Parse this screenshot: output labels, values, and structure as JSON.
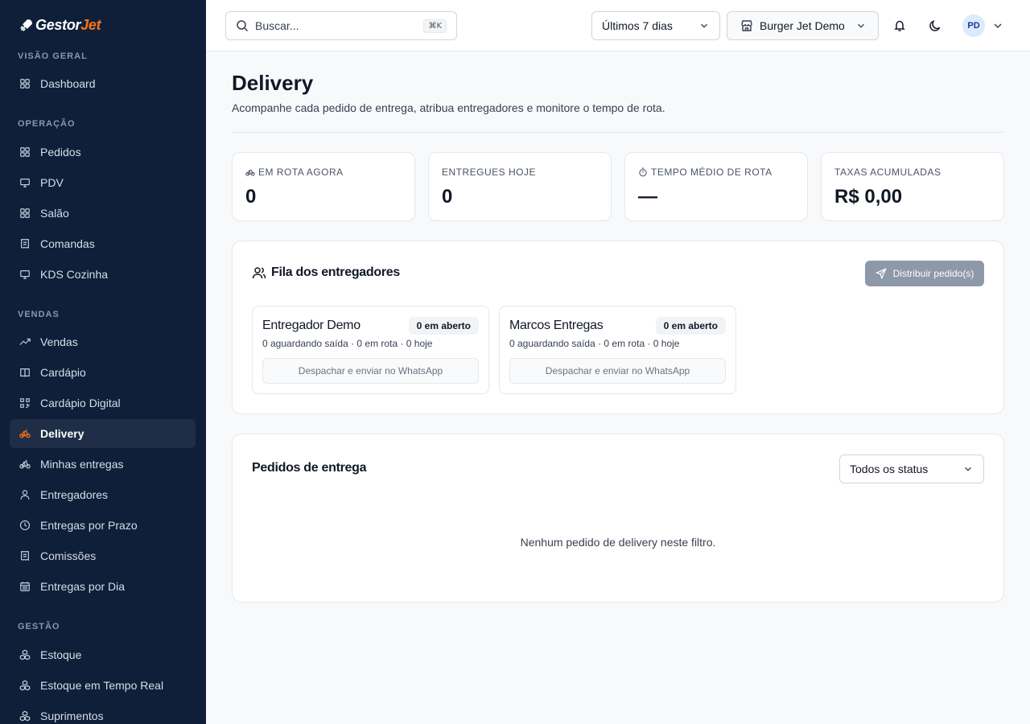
{
  "brand": {
    "name_prefix": "Gestor",
    "name_suffix": "Jet"
  },
  "sidebar": {
    "sections": [
      {
        "title": "VISÃO GERAL"
      },
      {
        "title": "OPERAÇÃO"
      },
      {
        "title": "VENDAS"
      },
      {
        "title": "GESTÃO"
      }
    ],
    "items": [
      {
        "label": "Dashboard",
        "icon": "grid-icon"
      },
      {
        "label": "Pedidos",
        "icon": "grid-icon"
      },
      {
        "label": "PDV",
        "icon": "monitor-icon"
      },
      {
        "label": "Salão",
        "icon": "grid-icon"
      },
      {
        "label": "Comandas",
        "icon": "receipt-icon"
      },
      {
        "label": "KDS Cozinha",
        "icon": "monitor-icon"
      },
      {
        "label": "Vendas",
        "icon": "trend-icon"
      },
      {
        "label": "Cardápio",
        "icon": "book-icon"
      },
      {
        "label": "Cardápio Digital",
        "icon": "qr-icon"
      },
      {
        "label": "Delivery",
        "icon": "bike-icon",
        "active": true
      },
      {
        "label": "Minhas entregas",
        "icon": "bike-icon"
      },
      {
        "label": "Entregadores",
        "icon": "user-icon"
      },
      {
        "label": "Entregas por Prazo",
        "icon": "clock-icon"
      },
      {
        "label": "Comissões",
        "icon": "receipt-icon"
      },
      {
        "label": "Entregas por Dia",
        "icon": "calendar-icon"
      },
      {
        "label": "Estoque",
        "icon": "boxes-icon"
      },
      {
        "label": "Estoque em Tempo Real",
        "icon": "boxes-icon"
      },
      {
        "label": "Suprimentos",
        "icon": "boxes-icon"
      }
    ]
  },
  "topbar": {
    "search_placeholder": "Buscar...",
    "search_shortcut": "⌘K",
    "period": "Últimos 7 dias",
    "store": "Burger Jet Demo",
    "avatar_initials": "PD"
  },
  "page": {
    "title": "Delivery",
    "subtitle": "Acompanhe cada pedido de entrega, atribua entregadores e monitore o tempo de rota."
  },
  "stats": [
    {
      "label": "EM ROTA AGORA",
      "value": "0",
      "icon": "bike-icon"
    },
    {
      "label": "ENTREGUES HOJE",
      "value": "0",
      "icon": ""
    },
    {
      "label": "TEMPO MÉDIO DE ROTA",
      "value": "—",
      "icon": "timer-icon"
    },
    {
      "label": "TAXAS ACUMULADAS",
      "value": "R$ 0,00",
      "icon": ""
    }
  ],
  "queue": {
    "title": "Fila dos entregadores",
    "distribute_label": "Distribuir pedido(s)",
    "couriers": [
      {
        "name": "Entregador Demo",
        "badge": "0 em aberto",
        "meta": "0 aguardando saída · 0 em rota · 0 hoje",
        "action": "Despachar e enviar no WhatsApp"
      },
      {
        "name": "Marcos Entregas",
        "badge": "0 em aberto",
        "meta": "0 aguardando saída · 0 em rota · 0 hoje",
        "action": "Despachar e enviar no WhatsApp"
      }
    ]
  },
  "orders": {
    "title": "Pedidos de entrega",
    "status_filter": "Todos os status",
    "empty_message": "Nenhum pedido de delivery neste filtro."
  },
  "colors": {
    "sidebar_bg": "#0f1f3a",
    "accent": "#f97316",
    "active_bg": "#1f2d46",
    "disabled_button": "#8d98a8"
  }
}
